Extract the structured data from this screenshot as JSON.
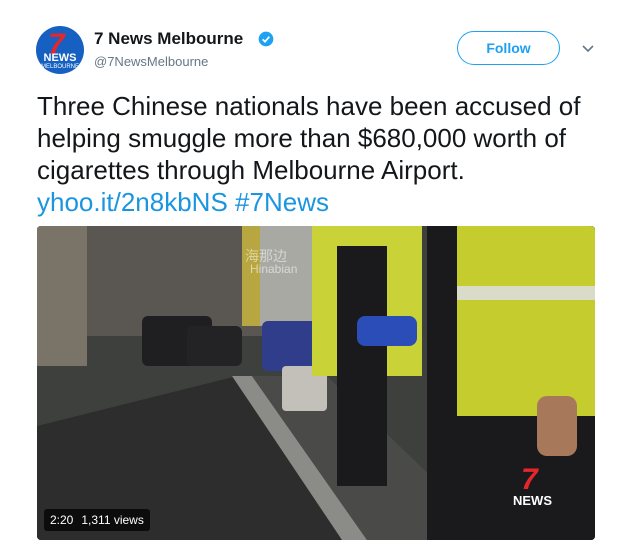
{
  "account": {
    "name": "7 News Melbourne",
    "handle": "@7NewsMelbourne",
    "avatar_text": "7",
    "avatar_news": "NEWS",
    "avatar_sub": "MELBOURNE",
    "verified": true
  },
  "follow_label": "Follow",
  "tweet": {
    "text": "Three Chinese nationals have been accused of helping smuggle more than $680,000 worth of cigarettes through Melbourne Airport.",
    "link": "yhoo.it/2n8kbNS",
    "hashtag": "#7News"
  },
  "video": {
    "duration": "2:20",
    "views": "1,311 views",
    "watermark_cn": "海那边",
    "watermark_en": "Hinabian",
    "logo_7": "7",
    "logo_news": "NEWS"
  },
  "colors": {
    "link": "#1b95e0",
    "follow": "#1da1f2",
    "brand_red": "#e5262b"
  }
}
